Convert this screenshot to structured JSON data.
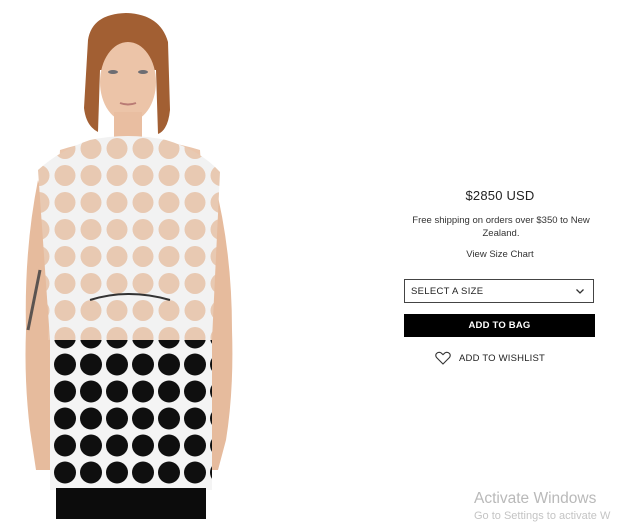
{
  "product": {
    "price": "$2850 USD",
    "shipping_note": "Free shipping on orders over $350 to New Zealand.",
    "size_chart_link": "View Size Chart",
    "size_select": "SELECT A SIZE",
    "add_to_bag": "ADD TO BAG",
    "add_to_wishlist": "ADD TO WISHLIST"
  },
  "icons": {
    "size_dropdown": "chevron-down-icon",
    "wishlist": "heart-icon"
  },
  "os_watermark": {
    "title": "Activate Windows",
    "subtitle": "Go to Settings to activate W"
  },
  "colors": {
    "button_bg": "#000000",
    "button_text": "#ffffff",
    "watermark": "#b9b9b9"
  }
}
